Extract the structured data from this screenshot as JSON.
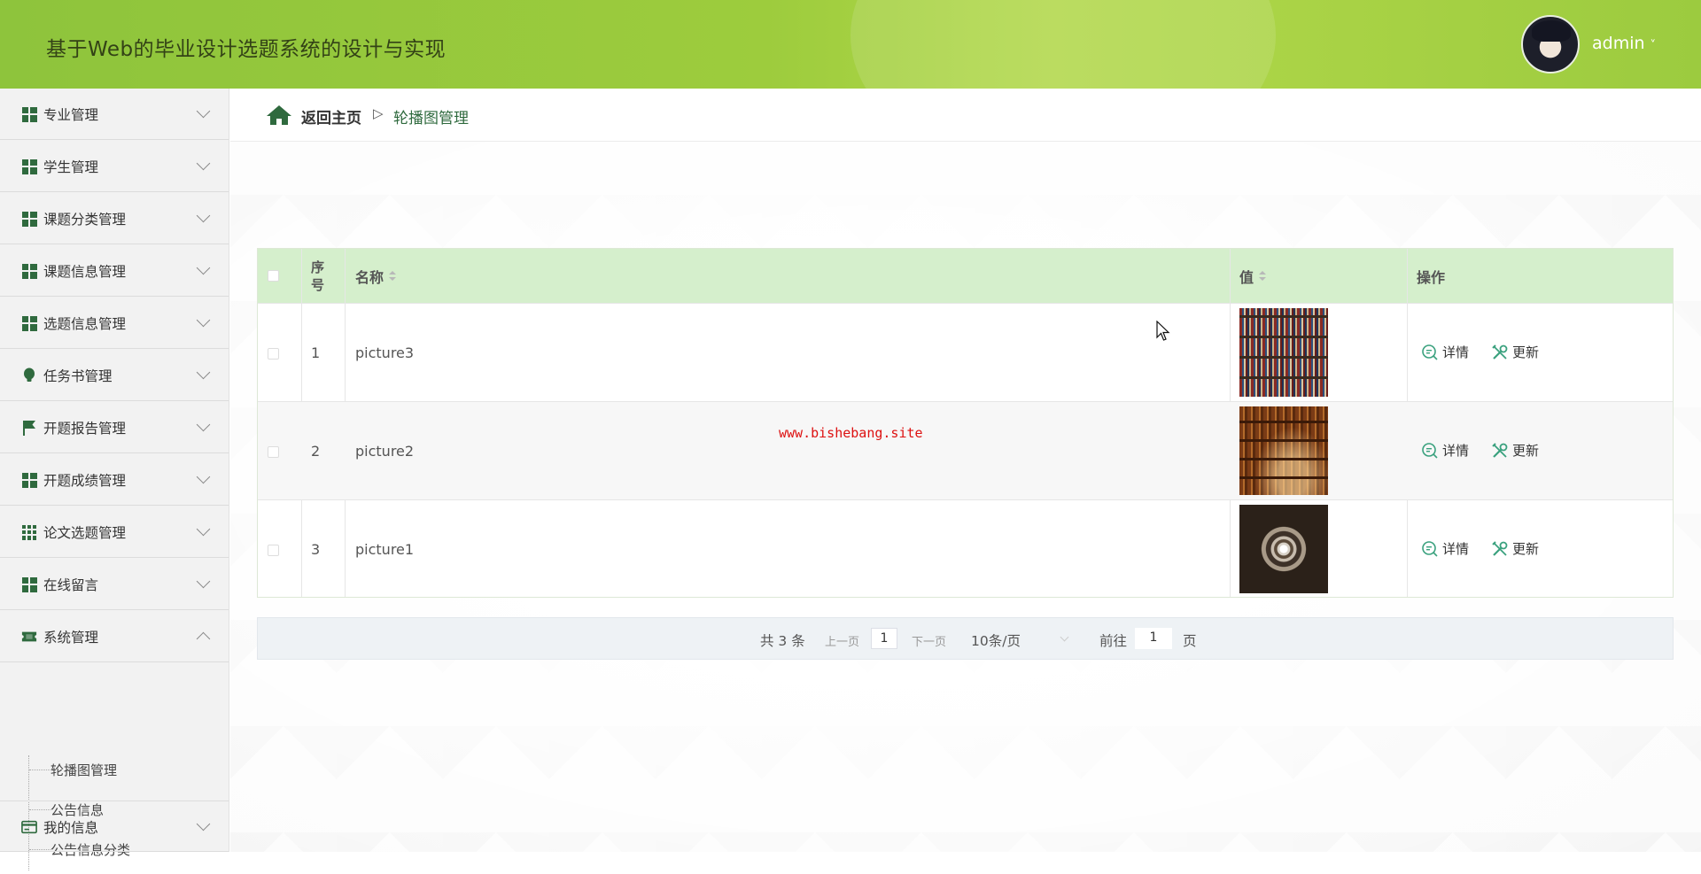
{
  "header": {
    "title": "基于Web的毕业设计选题系统的设计与实现",
    "user": "admin"
  },
  "sidebar": {
    "items": [
      {
        "label": "专业管理",
        "icon": "grid-icon"
      },
      {
        "label": "学生管理",
        "icon": "grid-icon"
      },
      {
        "label": "课题分类管理",
        "icon": "grid-icon"
      },
      {
        "label": "课题信息管理",
        "icon": "grid-icon"
      },
      {
        "label": "选题信息管理",
        "icon": "grid-icon"
      },
      {
        "label": "任务书管理",
        "icon": "bulb-icon"
      },
      {
        "label": "开题报告管理",
        "icon": "flag-icon"
      },
      {
        "label": "开题成绩管理",
        "icon": "grid-icon"
      },
      {
        "label": "论文选题管理",
        "icon": "grid9-icon"
      },
      {
        "label": "在线留言",
        "icon": "grid-icon"
      },
      {
        "label": "系统管理",
        "icon": "ticket-icon"
      },
      {
        "label": "我的信息",
        "icon": "card-icon"
      }
    ],
    "submenu": [
      "轮播图管理",
      "公告信息",
      "公告信息分类"
    ]
  },
  "breadcrumb": {
    "home": "返回主页",
    "separator": "▷",
    "current": "轮播图管理"
  },
  "table": {
    "headers": {
      "index": "序号",
      "name": "名称",
      "value": "值",
      "action": "操作"
    },
    "rows": [
      {
        "index": "1",
        "name": "picture3"
      },
      {
        "index": "2",
        "name": "picture2"
      },
      {
        "index": "3",
        "name": "picture1"
      }
    ],
    "actions": {
      "detail": "详情",
      "update": "更新"
    }
  },
  "watermark": "www.bishebang.site",
  "pagination": {
    "total": "共 3 条",
    "prev": "上一页",
    "current": "1",
    "next": "下一页",
    "page_size": "10条/页",
    "goto_label": "前往",
    "goto_value": "1",
    "goto_unit": "页"
  },
  "colors": {
    "header": "#9dcc3d",
    "accent": "#2f6a3e",
    "table_header": "#d5efcc"
  }
}
